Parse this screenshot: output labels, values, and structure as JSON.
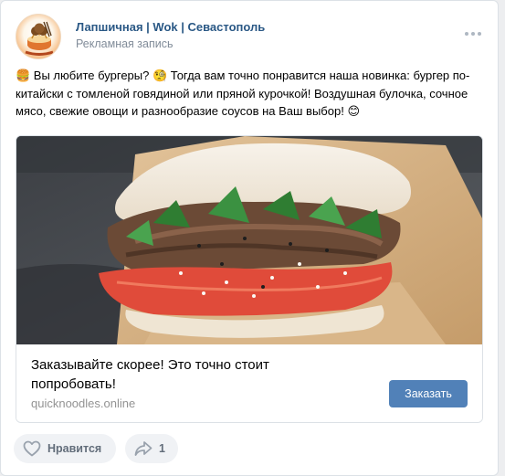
{
  "post": {
    "author": "Лапшичная | Wok | Севастополь",
    "subtitle": "Рекламная запись",
    "avatar_label": "Лапшичная",
    "text_1": " Вы любите бургеры? ",
    "text_2": " Тогда вам точно понравится наша новинка: бургер по-китайски с томленой говядиной или пряной курочкой! Воздушная булочка, сочное мясо, свежие овощи и разнообразие соусов на Ваш выбор! ",
    "emoji_1": "🍔",
    "emoji_2": "🧐",
    "emoji_3": "😊"
  },
  "ad": {
    "title": "Заказывайте скорее! Это точно стоит попробовать!",
    "domain": "quicknoodles.online",
    "button_label": "Заказать"
  },
  "footer": {
    "like_label": "Нравится",
    "share_count": "1"
  },
  "colors": {
    "link": "#2a5885",
    "button": "#5181b8",
    "muted": "#818c99"
  }
}
